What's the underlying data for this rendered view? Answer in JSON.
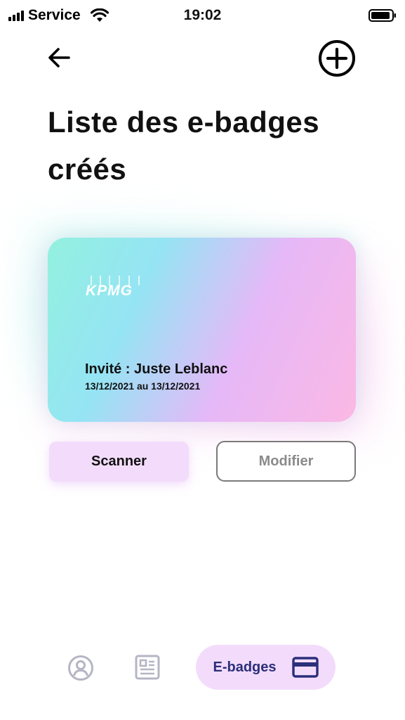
{
  "status_bar": {
    "carrier": "Service",
    "time": "19:02"
  },
  "header": {
    "title": "Liste des e-badges créés",
    "back_icon": "arrow-left-icon",
    "add_icon": "plus-circle-icon"
  },
  "badge": {
    "logo": "KPMG",
    "guest": "Invité : Juste Leblanc",
    "dates": "13/12/2021 au 13/12/2021",
    "gradient_colors": [
      "#93f1df",
      "#95e4f4",
      "#e6b8f7",
      "#fbb8e4"
    ]
  },
  "actions": {
    "scan_label": "Scanner",
    "edit_label": "Modifier"
  },
  "bottom_nav": {
    "items": [
      {
        "icon": "profile-icon"
      },
      {
        "icon": "document-icon"
      },
      {
        "label": "E-badges",
        "icon": "card-icon",
        "active": true
      }
    ]
  },
  "colors": {
    "accent_pill": "#f3dcfb",
    "nav_active_text": "#2b2f7a",
    "nav_inactive_icon": "#b5b5c4"
  }
}
